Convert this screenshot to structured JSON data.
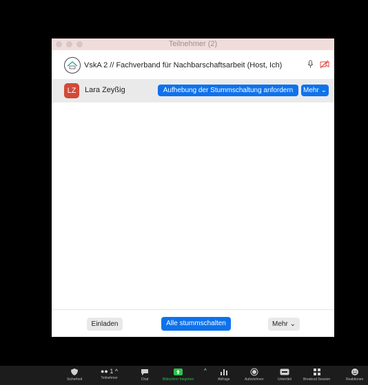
{
  "window": {
    "title": "Teilnehmer (2)"
  },
  "participants": [
    {
      "name": "VskA 2 // Fachverband für Nachbarschaftsarbeit (Host, Ich)"
    },
    {
      "initials": "LZ",
      "name": "Lara Zeyßig",
      "unmute_request_label": "Aufhebung der Stummschaltung anfordern",
      "more_label": "Mehr"
    }
  ],
  "footer": {
    "invite_label": "Einladen",
    "mute_all_label": "Alle stummschalten",
    "more_label": "Mehr"
  },
  "toolbar": {
    "security": "Sicherheit",
    "participants": "Teilnehmer",
    "participants_count": "1",
    "chat": "Chat",
    "share_screen": "Bildschirm freigeben",
    "poll": "Abfrage",
    "record": "Aufzeichnen",
    "subtitles": "Untertitel",
    "breakout": "Breakout Session",
    "reactions": "Reaktionen"
  }
}
